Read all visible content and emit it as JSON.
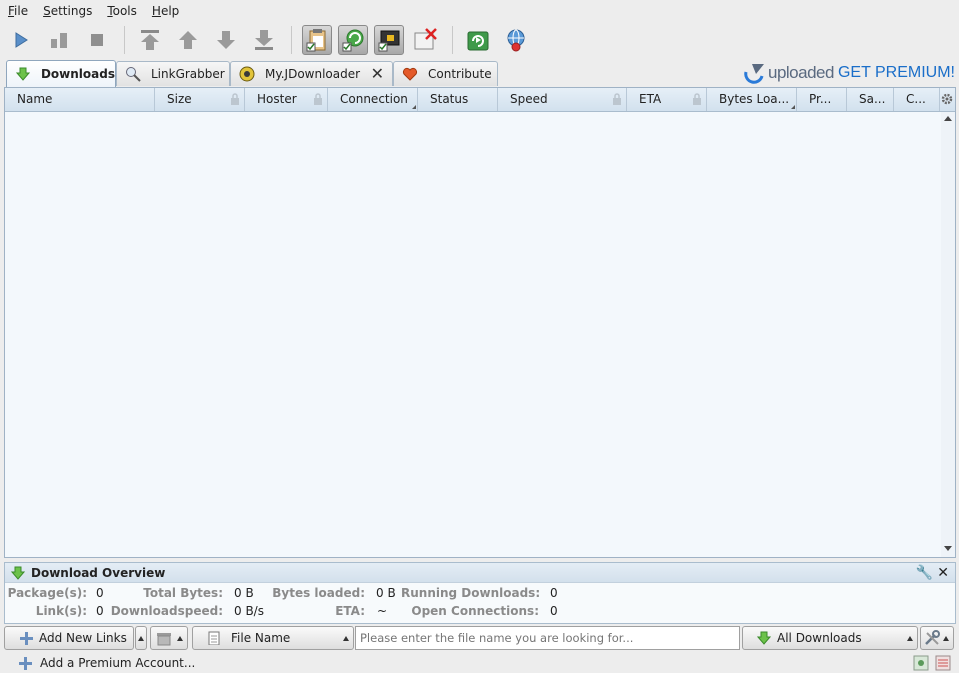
{
  "menu": [
    {
      "label": "File",
      "mnemonic": "F",
      "rest": "ile"
    },
    {
      "label": "Settings",
      "mnemonic": "S",
      "rest": "ettings"
    },
    {
      "label": "Tools",
      "mnemonic": "T",
      "rest": "ools"
    },
    {
      "label": "Help",
      "mnemonic": "H",
      "rest": "elp"
    }
  ],
  "toolbar": {
    "buttons": [
      "play-icon",
      "pause-icon",
      "stop-icon",
      "move-top-icon",
      "move-up-icon",
      "move-down-icon",
      "move-bottom-icon",
      "clipboard-observer-icon",
      "auto-reconnect-icon",
      "premium-toggle-icon",
      "speed-limit-icon",
      "reconnect-icon",
      "update-icon"
    ]
  },
  "tabs": {
    "downloads": "Downloads",
    "linkgrabber": "LinkGrabber",
    "myjd": "My.JDownloader",
    "contribute": "Contribute"
  },
  "banner": {
    "brand": "uploaded",
    "cta": "GET PREMIUM!"
  },
  "table": {
    "columns": [
      "Name",
      "Size",
      "Hoster",
      "Connection",
      "Status",
      "Speed",
      "ETA",
      "Bytes Loa...",
      "Pr...",
      "Sa...",
      "C..."
    ]
  },
  "overview": {
    "title": "Download Overview",
    "packages_label": "Package(s):",
    "packages": "0",
    "total_bytes_label": "Total Bytes:",
    "total_bytes": "0 B",
    "bytes_loaded_label": "Bytes loaded:",
    "bytes_loaded": "0 B",
    "running_label": "Running Downloads:",
    "running": "0",
    "links_label": "Link(s):",
    "links": "0",
    "speed_label": "Downloadspeed:",
    "speed": "0 B/s",
    "eta_label": "ETA:",
    "eta": "~",
    "connections_label": "Open Connections:",
    "connections": "0"
  },
  "bottom": {
    "add_links": "Add New Links",
    "search_field": "File Name",
    "search_placeholder": "Please enter the file name you are looking for...",
    "view": "All Downloads"
  },
  "status": {
    "add_premium": "Add a Premium Account..."
  },
  "colors": {
    "accent": "#1a6ec9",
    "header": "#d2e1ee",
    "table_bg": "#f3f8fc"
  }
}
